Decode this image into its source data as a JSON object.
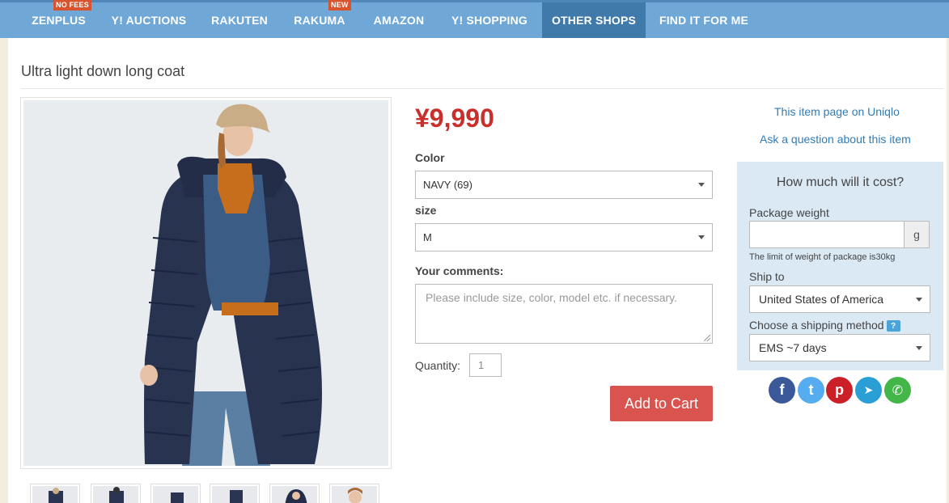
{
  "nav": {
    "items": [
      {
        "label": "ZENPLUS",
        "badge": "NO FEES"
      },
      {
        "label": "Y! AUCTIONS"
      },
      {
        "label": "RAKUTEN"
      },
      {
        "label": "RAKUMA",
        "badge": "NEW"
      },
      {
        "label": "AMAZON"
      },
      {
        "label": "Y! SHOPPING"
      },
      {
        "label": "OTHER SHOPS",
        "active": true
      },
      {
        "label": "FIND IT FOR ME"
      }
    ]
  },
  "product": {
    "title": "Ultra light down long coat",
    "price": "¥9,990",
    "color_label": "Color",
    "color_value": "NAVY (69)",
    "size_label": "size",
    "size_value": "M",
    "comments_label": "Your comments:",
    "comments_placeholder": "Please include size, color, model etc. if necessary.",
    "quantity_label": "Quantity:",
    "quantity_value": "1",
    "add_to_cart": "Add to Cart"
  },
  "links": {
    "item_page": "This item page on Uniqlo",
    "ask_question": "Ask a question about this item"
  },
  "cost": {
    "title": "How much will it cost?",
    "weight_label": "Package weight",
    "weight_unit": "g",
    "weight_note": "The limit of weight of package is30kg",
    "ship_to_label": "Ship to",
    "ship_to_value": "United States of America",
    "method_label": "Choose a shipping method",
    "method_help": "?",
    "method_value": "EMS ~7 days"
  },
  "share": [
    {
      "icon": "facebook-icon",
      "glyph": "f",
      "color": "#3b5998"
    },
    {
      "icon": "twitter-icon",
      "glyph": "t",
      "color": "#55acee"
    },
    {
      "icon": "pinterest-icon",
      "glyph": "p",
      "color": "#cb2027"
    },
    {
      "icon": "telegram-icon",
      "glyph": "➤",
      "color": "#2a9fd6"
    },
    {
      "icon": "whatsapp-icon",
      "glyph": "✆",
      "color": "#43b649"
    }
  ],
  "colors": {
    "nav_bg": "#6fa8d6",
    "nav_active": "#3f7aaa",
    "price": "#c9302c",
    "cart_button": "#d9534f",
    "link": "#2f7cb8",
    "cost_panel": "#dbe9f4"
  }
}
